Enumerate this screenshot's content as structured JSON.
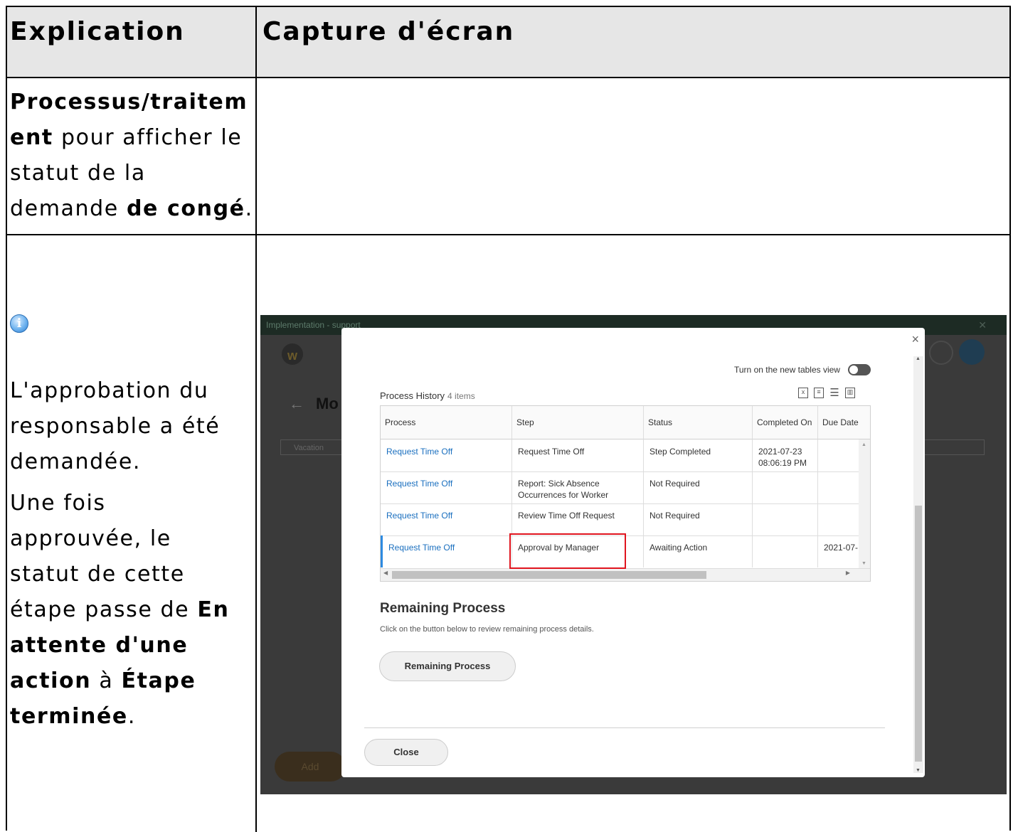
{
  "table_header": {
    "col1": "Explication",
    "col2": "Capture d'écran"
  },
  "row1": {
    "p1_bold": "Processus/traitem",
    "p2_bold": "ent",
    "p2_rest": " pour afficher le",
    "p3": "statut de la",
    "p4_pre": "demande ",
    "p4_bold": "de congé",
    "p4_post": "."
  },
  "row2": {
    "l1": "L'approbation du",
    "l2": "responsable a été",
    "l3": "demandée.",
    "l4": "Une fois",
    "l5": "approuvée, le",
    "l6": "statut de cette",
    "l7_pre": "étape passe de ",
    "l7_bold": "En",
    "l8_bold": "attente d'une",
    "l9_bold": "action",
    "l9_mid": " à ",
    "l9_bold2": "Étape",
    "l10_bold": "terminée",
    "l10_post": "."
  },
  "screenshot": {
    "window_title": "Implementation - support",
    "bg_title": "Mo",
    "bg_tag": "Vacation",
    "bg_add": "Add",
    "toggle_label": "Turn on the new tables view",
    "process_history_title": "Process History",
    "process_history_count": "4 items",
    "columns": [
      "Process",
      "Step",
      "Status",
      "Completed On",
      "Due Date"
    ],
    "rows": [
      {
        "process": "Request Time Off",
        "step": "Request Time Off",
        "status": "Step Completed",
        "completed_line1": "2021-07-23",
        "completed_line2": "08:06:19 PM",
        "due": ""
      },
      {
        "process": "Request Time Off",
        "step_line1": "Report: Sick Absence",
        "step_line2": "Occurrences for Worker",
        "status": "Not Required",
        "due": ""
      },
      {
        "process": "Request Time Off",
        "step": "Review Time Off Request",
        "status": "Not Required",
        "due": ""
      },
      {
        "process": "Request Time Off",
        "step": "Approval by Manager",
        "status": "Awaiting Action",
        "due": "2021-07-"
      }
    ],
    "remaining_title": "Remaining Process",
    "remaining_desc": "Click on the button below to review remaining process details.",
    "remaining_button": "Remaining Process",
    "close_button": "Close"
  },
  "colors": {
    "header_bg": "#e6e6e6",
    "link": "#1a6fbf",
    "highlight": "#e0141e"
  }
}
